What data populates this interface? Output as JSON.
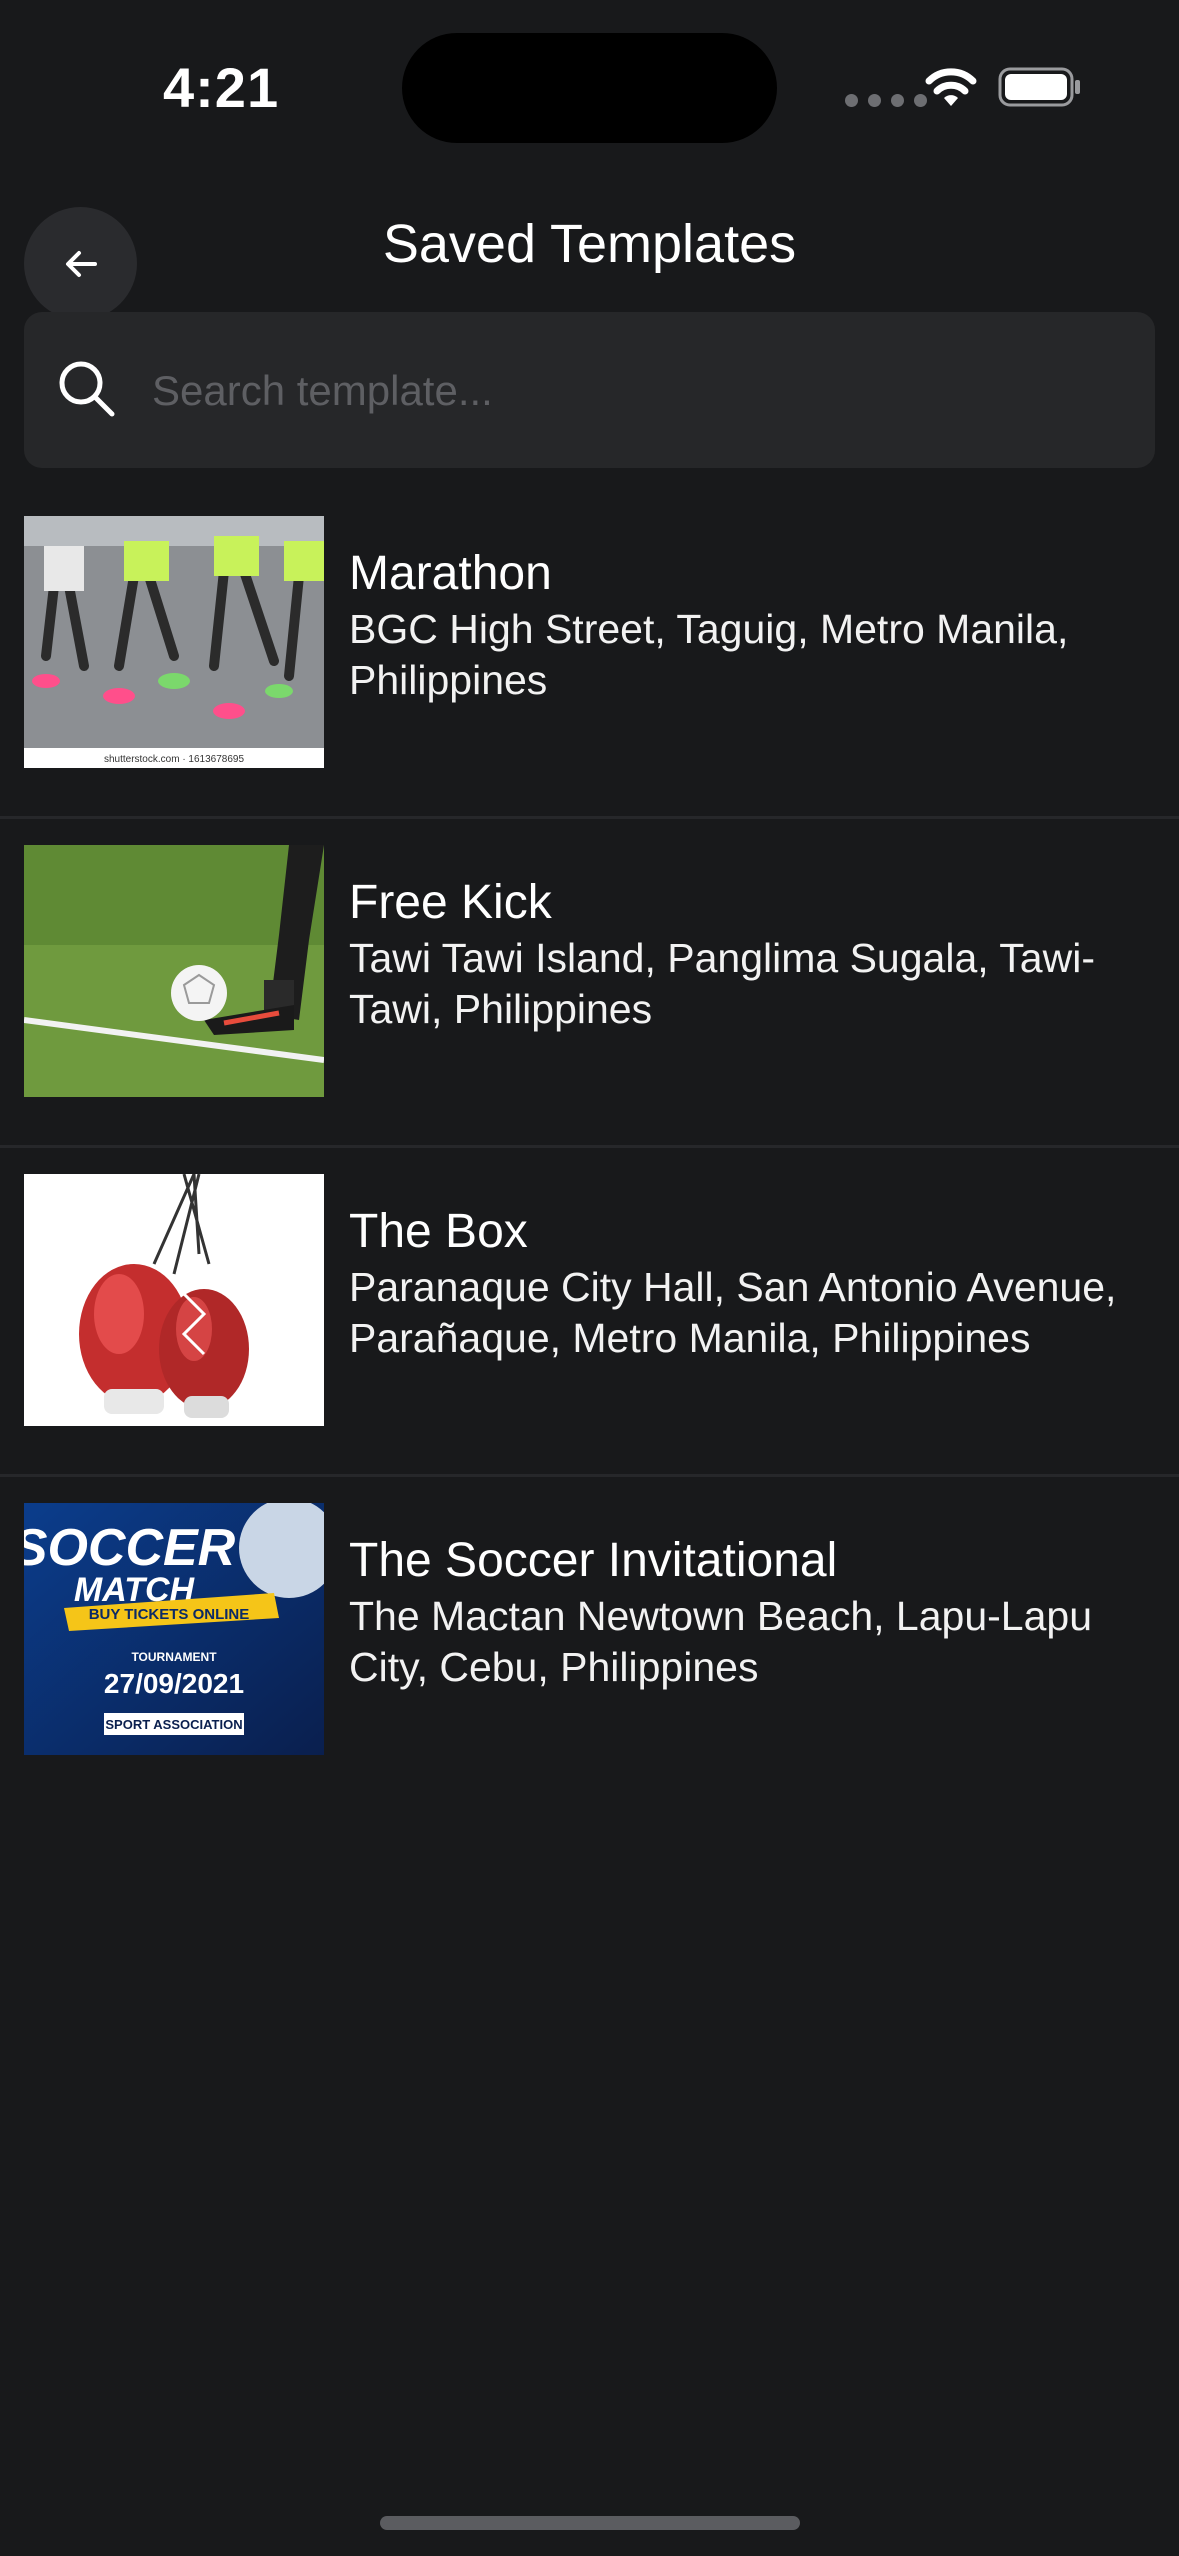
{
  "status_bar": {
    "time": "4:21"
  },
  "header": {
    "title": "Saved Templates",
    "back_icon": "arrow-left-icon"
  },
  "search": {
    "placeholder": "Search template...",
    "value": "",
    "icon": "search-icon"
  },
  "templates": [
    {
      "title": "Marathon",
      "location": "BGC High Street, Taguig, Metro Manila, Philippines",
      "thumb_caption": "shutterstock.com · 1613678695"
    },
    {
      "title": "Free Kick",
      "location": "Tawi Tawi Island, Panglima Sugala, Tawi-Tawi, Philippines"
    },
    {
      "title": "The Box",
      "location": "Paranaque City Hall, San Antonio Avenue, Parañaque, Metro Manila, Philippines"
    },
    {
      "title": "The Soccer Invitational",
      "location": "The Mactan Newtown Beach, Lapu-Lapu City, Cebu, Philippines",
      "poster": {
        "headline_1": "SOCCER",
        "headline_2": "MATCH",
        "ribbon": "BUY TICKETS ONLINE",
        "label": "TOURNAMENT",
        "date": "27/09/2021",
        "org": "SPORT ASSOCIATION"
      }
    }
  ],
  "colors": {
    "background": "#18191b",
    "search_bg": "#262729",
    "divider": "#26272a"
  }
}
